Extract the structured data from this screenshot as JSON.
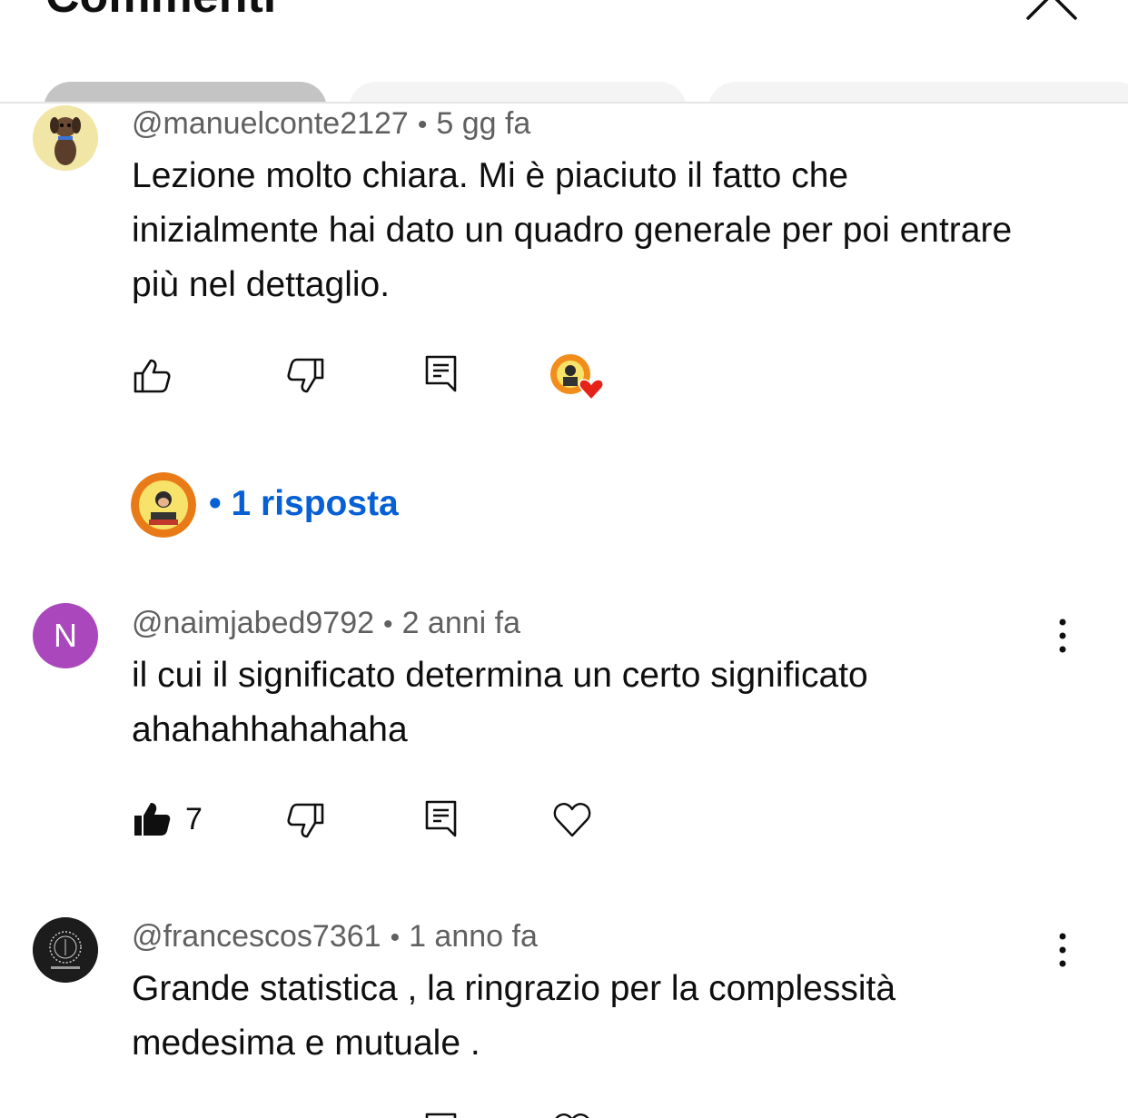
{
  "header": {
    "title": "Commenti",
    "settings_icon": "gear-icon",
    "close_icon": "close-icon"
  },
  "comments": [
    {
      "author": "@manuelconte2127",
      "time": "5 gg fa",
      "text": "Lezione molto chiara. Mi è piaciuto il fatto che inizialmente hai dato un quadro generale per poi entrare più nel dettaglio.",
      "creator_hearted": true,
      "replies_label": "1 risposta"
    },
    {
      "author": "@naimjabed9792",
      "avatar_letter": "N",
      "time": "2 anni fa",
      "text": "il cui il significato determina un certo significato ahahahhahahaha",
      "likes": "7"
    },
    {
      "author": "@francescos7361",
      "time": "1 anno fa",
      "text": "Grande statistica , la ringrazio per la complessità medesima e mutuale ."
    }
  ],
  "colors": {
    "link": "#065fd4",
    "avatar_n": "#ab47bc",
    "heart": "#e62117"
  }
}
